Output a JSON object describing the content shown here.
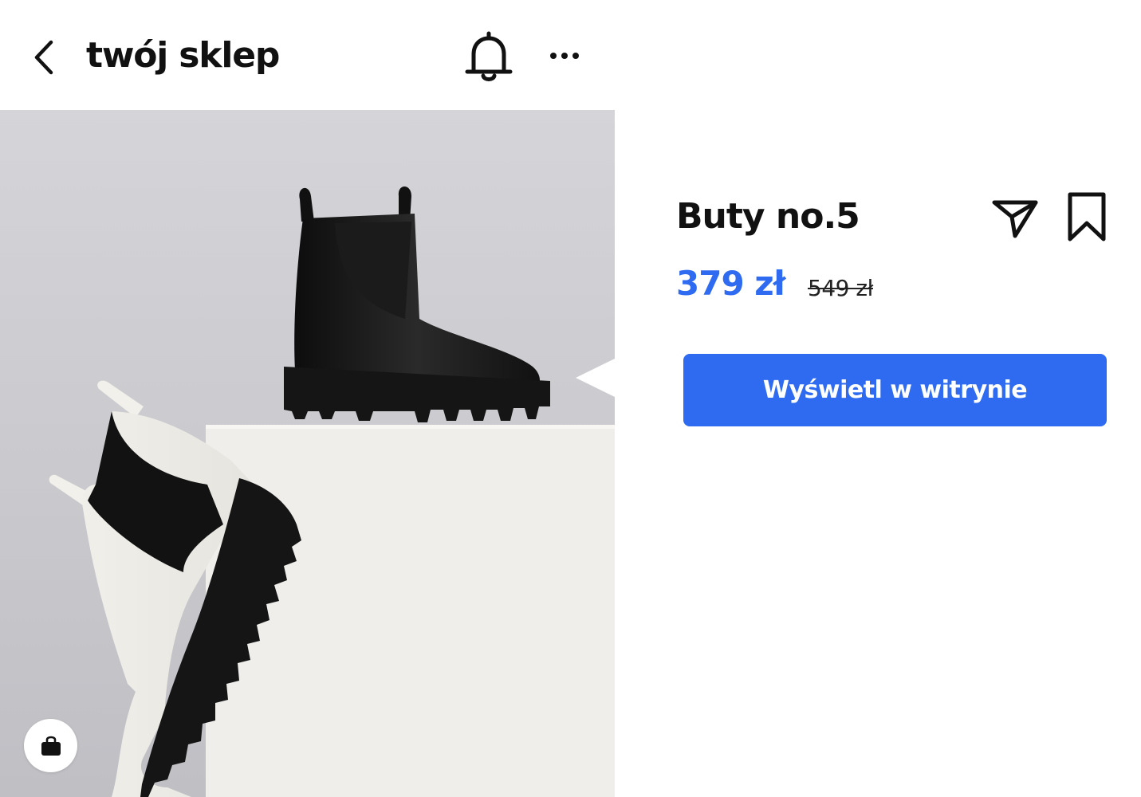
{
  "header": {
    "store_name": "twój sklep",
    "back_icon": "chevron-left-icon",
    "notification_icon": "bell-icon",
    "more_icon": "ellipsis-icon"
  },
  "product": {
    "name": "Buty no.5",
    "price": "379 zł",
    "old_price": "549 zł",
    "cta_label": "Wyświetl w witrynie",
    "share_icon": "send-icon",
    "save_icon": "bookmark-icon",
    "shopping_icon": "shopping-bag-icon"
  },
  "colors": {
    "accent": "#2E6BF0",
    "text": "#111111",
    "background": "#FFFFFF"
  }
}
